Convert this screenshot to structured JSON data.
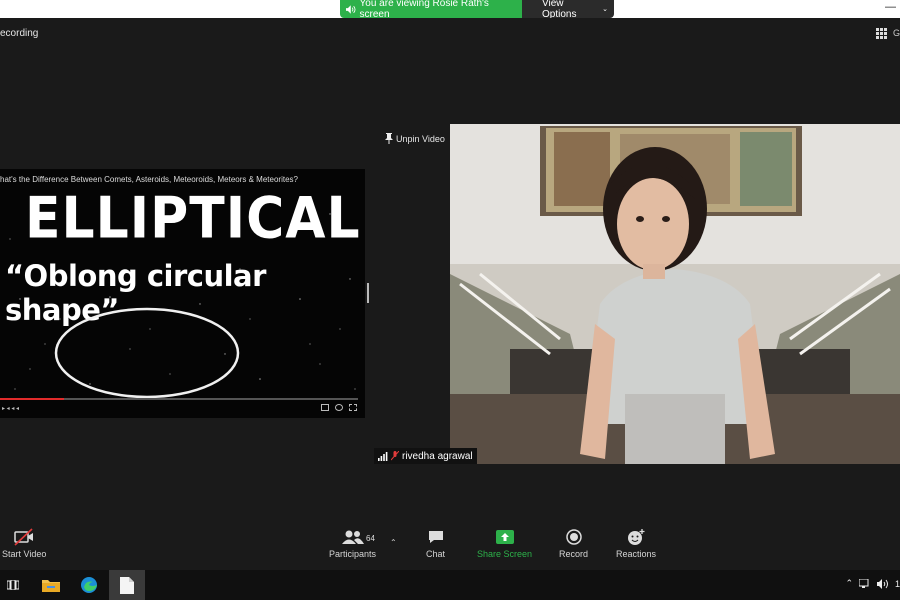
{
  "banner": {
    "viewing_text": "You are viewing Rosie Rath's screen",
    "view_options_label": "View Options"
  },
  "recording_label": "ecording",
  "gallery_label": "G",
  "shared_video": {
    "title": "hat's the Difference Between Comets, Asteroids, Meteoroids, Meteors & Meteorites?",
    "heading": "ELLIPTICAL",
    "subheading": "“Oblong circular shape”",
    "progress": 0.18,
    "time_label": "▸ ◂ ◂ ◂"
  },
  "participant": {
    "unpin_label": "Unpin Video",
    "name": "rivedha agrawal"
  },
  "toolbar": {
    "start_video": "Start Video",
    "participants": "Participants",
    "participants_count": "64",
    "chat": "Chat",
    "share_screen": "Share Screen",
    "record": "Record",
    "reactions": "Reactions"
  },
  "taskbar": {
    "clock": "1"
  },
  "colors": {
    "accent_green": "#2db14a",
    "progress_red": "#e22b2b",
    "background": "#1a1a1a"
  }
}
